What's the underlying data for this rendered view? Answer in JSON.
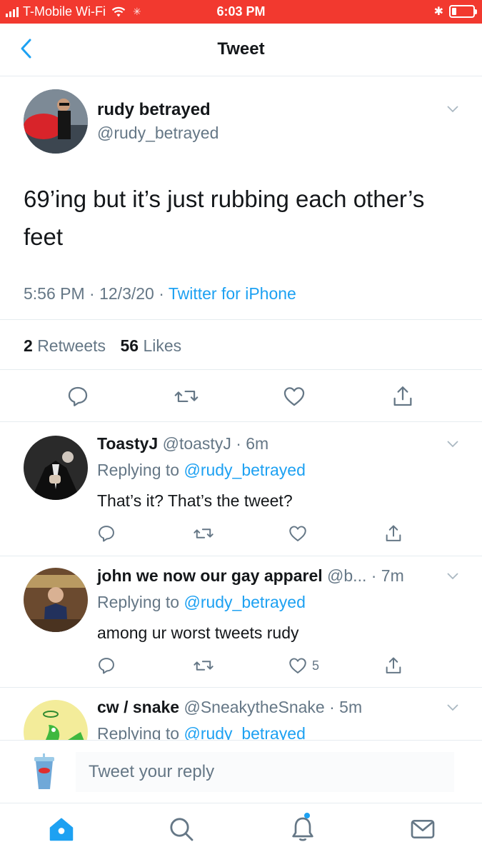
{
  "status_bar": {
    "carrier": "T-Mobile Wi-Fi",
    "time": "6:03 PM",
    "icons": [
      "signal-icon",
      "wifi-icon",
      "activity-spinner-icon",
      "bluetooth-icon",
      "battery-icon"
    ],
    "background_color": "#f2392f"
  },
  "nav": {
    "title": "Tweet",
    "back_icon": "chevron-left-icon"
  },
  "tweet": {
    "name": "rudy betrayed",
    "handle": "@rudy_betrayed",
    "text": "69’ing but it’s just rubbing each other’s feet",
    "time_date": "5:56 PM · 12/3/20 · ",
    "source": "Twitter for iPhone",
    "retweets_count": "2",
    "retweets_label": "Retweets",
    "likes_count": "56",
    "likes_label": "Likes",
    "actions": [
      "reply-icon",
      "retweet-icon",
      "like-icon",
      "share-icon"
    ]
  },
  "replies": [
    {
      "name": "ToastyJ",
      "handle_time": "@toastyJ · 6m",
      "replying_prefix": "Replying to ",
      "replying_to": "@rudy_betrayed",
      "text": "That’s it? That’s the tweet?",
      "like_count": ""
    },
    {
      "name": "john we now our gay apparel",
      "handle_time": "@b... · 7m",
      "replying_prefix": "Replying to ",
      "replying_to": "@rudy_betrayed",
      "text": "among ur worst tweets rudy",
      "like_count": "5"
    },
    {
      "name": "cw / snake",
      "handle_time": "@SneakytheSnake · 5m",
      "replying_prefix": "Replying to ",
      "replying_to": "@rudy_betrayed",
      "text": "",
      "like_count": ""
    }
  ],
  "composer": {
    "placeholder": "Tweet your reply"
  },
  "tabbar": {
    "tabs": [
      "home-icon",
      "search-icon",
      "notifications-icon",
      "messages-icon"
    ],
    "accent_color": "#1da1f2"
  }
}
